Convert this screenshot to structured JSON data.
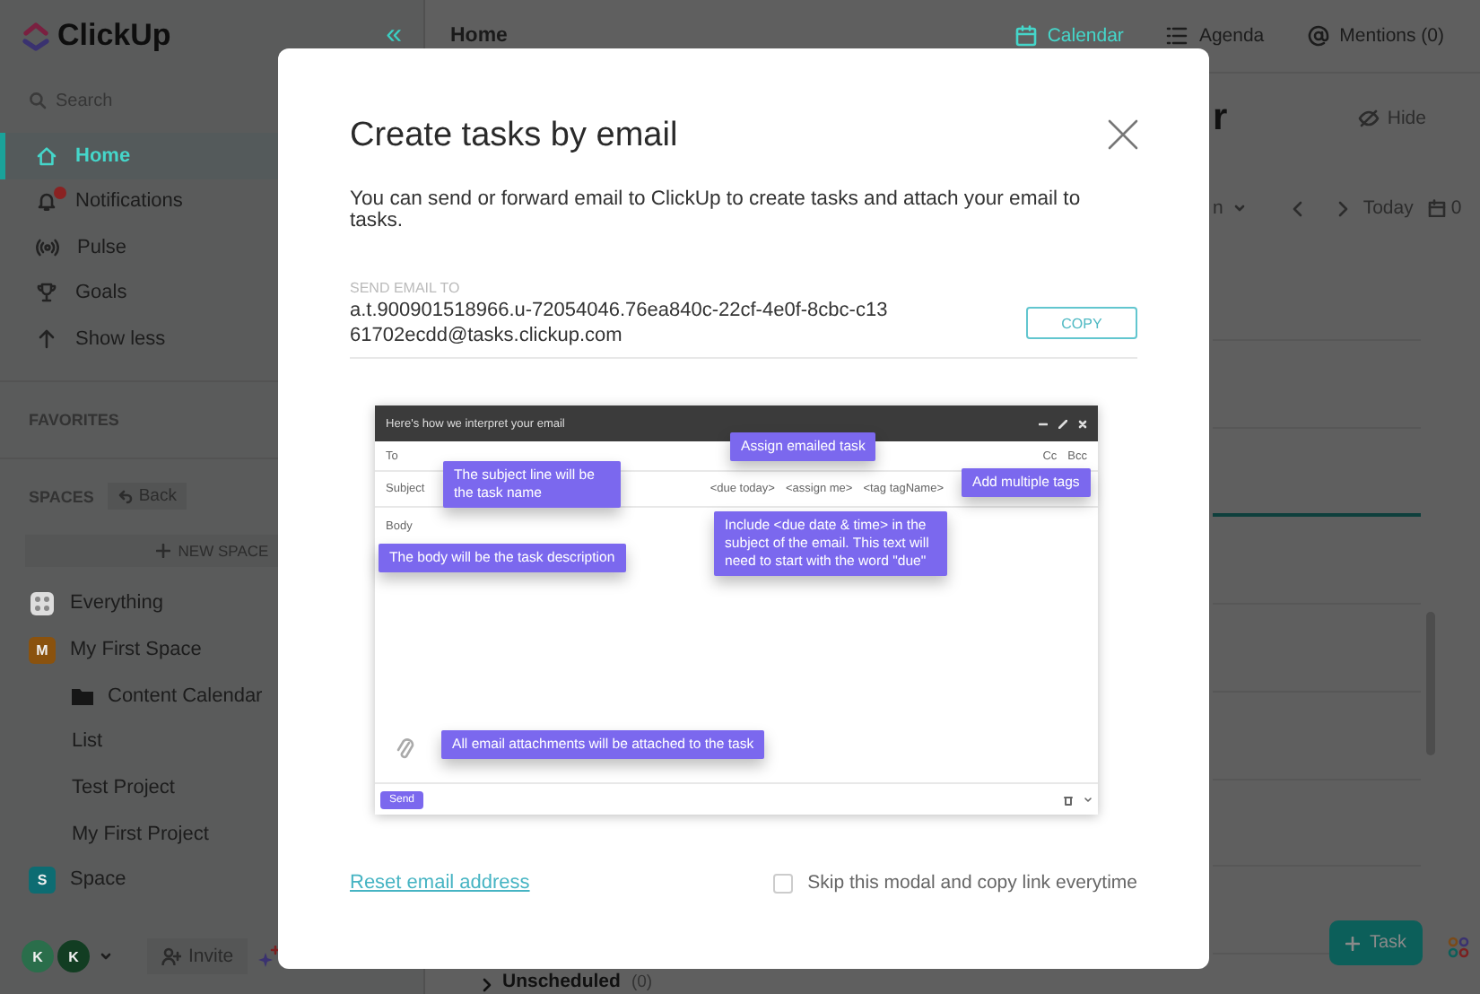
{
  "sidebar": {
    "logo": "ClickUp",
    "collapse": "«",
    "search": {
      "placeholder": "Search"
    },
    "nav": [
      {
        "kind": "home",
        "label": "Home",
        "selected": true,
        "alert": false
      },
      {
        "kind": "notifications",
        "label": "Notifications",
        "selected": false,
        "alert": true
      },
      {
        "kind": "pulse",
        "label": "Pulse",
        "selected": false,
        "alert": false
      },
      {
        "kind": "goals",
        "label": "Goals",
        "selected": false,
        "alert": false
      },
      {
        "kind": "less",
        "label": "Show less",
        "selected": false,
        "alert": false
      }
    ],
    "favorites_heading": "FAVORITES",
    "spaces_heading": "SPACES",
    "back": "Back",
    "new_space": "NEW SPACE",
    "spaces": [
      {
        "kind": "everything",
        "label": "Everything"
      },
      {
        "kind": "space",
        "label": "My First Space",
        "avatar": "M",
        "color": "#8a520e",
        "children": [
          {
            "kind": "folder",
            "label": "Content Calendar"
          },
          {
            "kind": "list",
            "label": "List"
          },
          {
            "kind": "list",
            "label": "Test Project"
          },
          {
            "kind": "list",
            "label": "My First Project"
          }
        ]
      },
      {
        "kind": "space",
        "label": "Space",
        "avatar": "S",
        "color": "#0d6c72"
      }
    ],
    "avatars": [
      {
        "initial": "K",
        "color": "#2a6e4b"
      },
      {
        "initial": "K",
        "color": "#123d22"
      }
    ],
    "invite": "Invite"
  },
  "header": {
    "title": "Home",
    "views": [
      {
        "kind": "calendar",
        "label": "Calendar",
        "selected": true
      },
      {
        "kind": "agenda",
        "label": "Agenda",
        "selected": false
      },
      {
        "kind": "mentions",
        "label": "Mentions (0)",
        "selected": false
      }
    ]
  },
  "calendar": {
    "title_fragment": "r",
    "hide": "Hide",
    "mode_fragment": "n",
    "today": "Today",
    "count": "0",
    "unscheduled": "Unscheduled",
    "unscheduled_count": "(0)",
    "add_task": "Task"
  },
  "modal": {
    "title": "Create tasks by email",
    "description": "You can send or forward email to ClickUp to create tasks and attach your email to tasks.",
    "address_label": "SEND EMAIL TO",
    "address": "a.t.900901518966.u-72054046.76ea840c-22cf-4e0f-8cbc-c1361702ecdd@tasks.clickup.com",
    "copy": "COPY",
    "illustration": {
      "header": "Here's how we interpret your email",
      "to": "To",
      "cc": "Cc",
      "bcc": "Bcc",
      "subject": "Subject",
      "tokens": [
        "<due today>",
        "<assign me>",
        "<tag tagName>"
      ],
      "body": "Body",
      "send": "Send",
      "callouts": [
        {
          "kind": "assign",
          "text": "Assign emailed task"
        },
        {
          "kind": "subject",
          "text": "The subject line will be the task name"
        },
        {
          "kind": "tags",
          "text": "Add multiple tags"
        },
        {
          "kind": "body",
          "text": "The body will be the task description"
        },
        {
          "kind": "due",
          "text": "Include <due date & time> in the subject of the email. This text will need to start with the word \"due\""
        },
        {
          "kind": "attachments",
          "text": "All email attachments will be attached to the task"
        }
      ]
    },
    "reset_link": "Reset email address",
    "skip": {
      "label": "Skip this modal and copy link everytime",
      "checked": false
    }
  }
}
